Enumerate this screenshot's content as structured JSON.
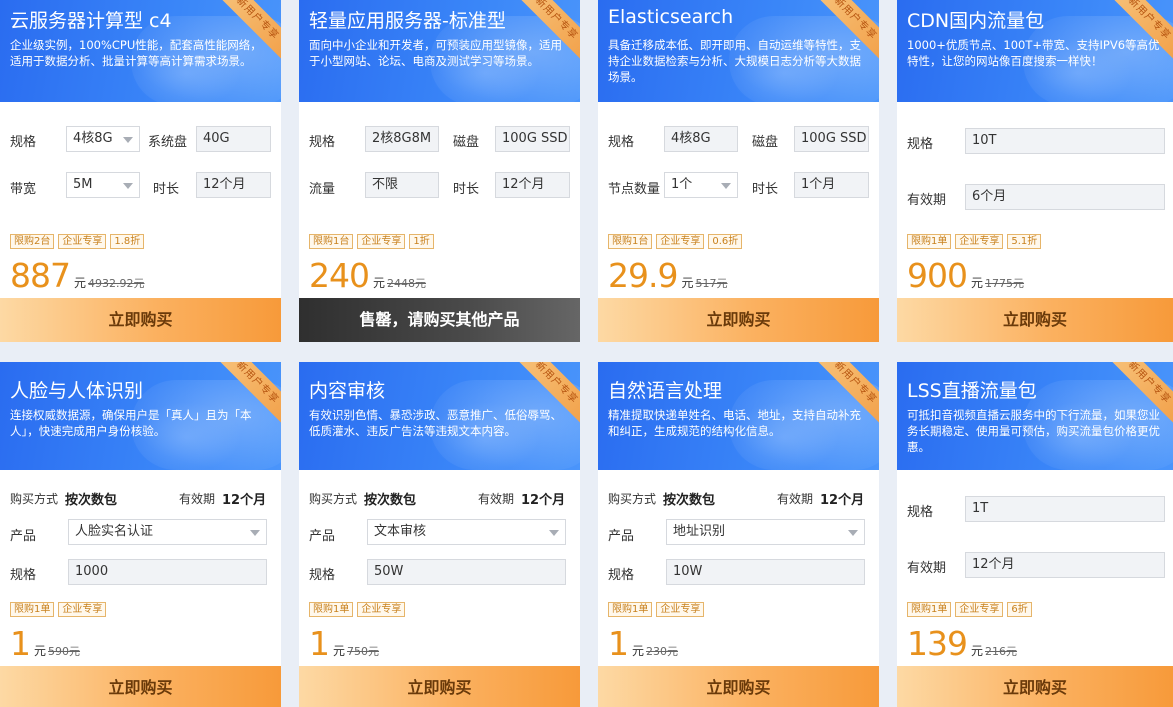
{
  "ribbon": "新用户专享",
  "cards": [
    {
      "title": "云服务器计算型 c4",
      "desc": "企业级实例，100%CPU性能，配套高性能网络，适用于数据分析、批量计算等高计算需求场景。",
      "f1_label": "规格",
      "f1_value": "4核8G",
      "f2_label": "系统盘",
      "f2_value": "40G",
      "f3_label": "带宽",
      "f3_value": "5M",
      "f4_label": "时长",
      "f4_value": "12个月",
      "tags": [
        "限购2台",
        "企业专享",
        "1.8折"
      ],
      "price": "887",
      "unit": "元",
      "orig": "4932.92元",
      "buy": "立即购买"
    },
    {
      "title": "轻量应用服务器-标准型",
      "desc": "面向中小企业和开发者，可预装应用型镜像，适用于小型网站、论坛、电商及测试学习等场景。",
      "f1_label": "规格",
      "f1_value": "2核8G8M",
      "f2_label": "磁盘",
      "f2_value": "100G SSD",
      "f3_label": "流量",
      "f3_value": "不限",
      "f4_label": "时长",
      "f4_value": "12个月",
      "tags": [
        "限购1台",
        "企业专享",
        "1折"
      ],
      "price": "240",
      "unit": "元",
      "orig": "2448元",
      "buy": "售罄，请购买其他产品"
    },
    {
      "title": "Elasticsearch",
      "desc": "具备迁移成本低、即开即用、自动运维等特性，支持企业数据检索与分析、大规模日志分析等大数据场景。",
      "f1_label": "规格",
      "f1_value": "4核8G",
      "f2_label": "磁盘",
      "f2_value": "100G SSD",
      "f3_label": "节点数量",
      "f3_value": "1个",
      "f4_label": "时长",
      "f4_value": "1个月",
      "tags": [
        "限购1台",
        "企业专享",
        "0.6折"
      ],
      "price": "29.9",
      "unit": "元",
      "orig": "517元",
      "buy": "立即购买"
    },
    {
      "title": "CDN国内流量包",
      "desc": "1000+优质节点、100T+带宽、支持IPV6等高优特性，让您的网站像百度搜索一样快！",
      "f1_label": "规格",
      "f1_value": "10T",
      "f2_label": "有效期",
      "f2_value": "6个月",
      "tags": [
        "限购1单",
        "企业专享",
        "5.1折"
      ],
      "price": "900",
      "unit": "元",
      "orig": "1775元",
      "buy": "立即购买"
    },
    {
      "title": "人脸与人体识别",
      "desc": "连接权威数据源，确保用户是「真人」且为「本人」，快速完成用户身份核验。",
      "buy_way_label": "购买方式",
      "buy_way_value": "按次数包",
      "valid_label": "有效期",
      "valid_value": "12个月",
      "product_label": "产品",
      "product_value": "人脸实名认证",
      "spec_label": "规格",
      "spec_value": "1000",
      "tags": [
        "限购1单",
        "企业专享"
      ],
      "price": "1",
      "unit": "元",
      "orig": "590元",
      "buy": "立即购买"
    },
    {
      "title": "内容审核",
      "desc": "有效识别色情、暴恐涉政、恶意推广、低俗辱骂、低质灌水、违反广告法等违规文本内容。",
      "buy_way_label": "购买方式",
      "buy_way_value": "按次数包",
      "valid_label": "有效期",
      "valid_value": "12个月",
      "product_label": "产品",
      "product_value": "文本审核",
      "spec_label": "规格",
      "spec_value": "50W",
      "tags": [
        "限购1单",
        "企业专享"
      ],
      "price": "1",
      "unit": "元",
      "orig": "750元",
      "buy": "立即购买"
    },
    {
      "title": "自然语言处理",
      "desc": "精准提取快递单姓名、电话、地址，支持自动补充和纠正，生成规范的结构化信息。",
      "buy_way_label": "购买方式",
      "buy_way_value": "按次数包",
      "valid_label": "有效期",
      "valid_value": "12个月",
      "product_label": "产品",
      "product_value": "地址识别",
      "spec_label": "规格",
      "spec_value": "10W",
      "tags": [
        "限购1单",
        "企业专享"
      ],
      "price": "1",
      "unit": "元",
      "orig": "230元",
      "buy": "立即购买"
    },
    {
      "title": "LSS直播流量包",
      "desc": "可抵扣音视频直播云服务中的下行流量，如果您业务长期稳定、使用量可预估，购买流量包价格更优惠。",
      "f1_label": "规格",
      "f1_value": "1T",
      "f2_label": "有效期",
      "f2_value": "12个月",
      "tags": [
        "限购1单",
        "企业专享",
        "6折"
      ],
      "price": "139",
      "unit": "元",
      "orig": "216元",
      "buy": "立即购买"
    }
  ]
}
